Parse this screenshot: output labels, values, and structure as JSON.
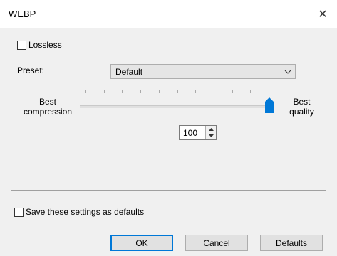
{
  "window": {
    "title": "WEBP"
  },
  "lossless": {
    "label": "Lossless",
    "checked": false
  },
  "preset": {
    "label": "Preset:",
    "value": "Default"
  },
  "quality": {
    "left_label": "Best compression",
    "right_label": "Best quality",
    "value": "100",
    "slider_fraction": 1.0
  },
  "save_defaults": {
    "label": "Save these settings as defaults",
    "checked": false
  },
  "buttons": {
    "ok": "OK",
    "cancel": "Cancel",
    "defaults": "Defaults"
  },
  "colors": {
    "thumb": "#0078d7",
    "dialog_bg": "#f0f0f0",
    "accent": "#0078d7"
  },
  "icons": {
    "close": "close-icon",
    "dropdown": "chevron-down-icon",
    "spin_up": "arrow-up-icon",
    "spin_down": "arrow-down-icon"
  }
}
